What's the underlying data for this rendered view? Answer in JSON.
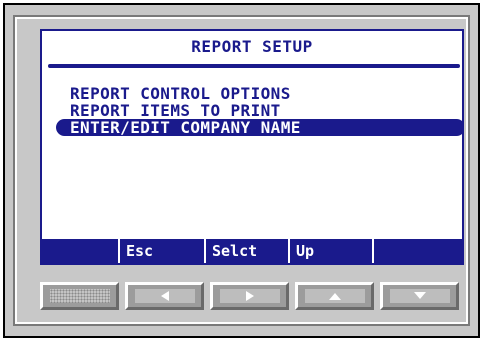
{
  "screen": {
    "title": "REPORT SETUP",
    "menu_items": [
      "REPORT CONTROL OPTIONS",
      "REPORT ITEMS TO PRINT",
      "ENTER/EDIT COMPANY NAME"
    ],
    "selected_index": 2
  },
  "softkeys": [
    "",
    "Esc",
    "Selct",
    "Up",
    ""
  ],
  "hardware_buttons": [
    {
      "icon": "blank-icon"
    },
    {
      "icon": "arrow-left-icon"
    },
    {
      "icon": "arrow-right-icon"
    },
    {
      "icon": "arrow-up-icon"
    },
    {
      "icon": "arrow-down-icon"
    }
  ],
  "colors": {
    "lcd_text": "#1a1a8c",
    "lcd_background": "#ffffff",
    "bezel": "#c8c8c8"
  }
}
